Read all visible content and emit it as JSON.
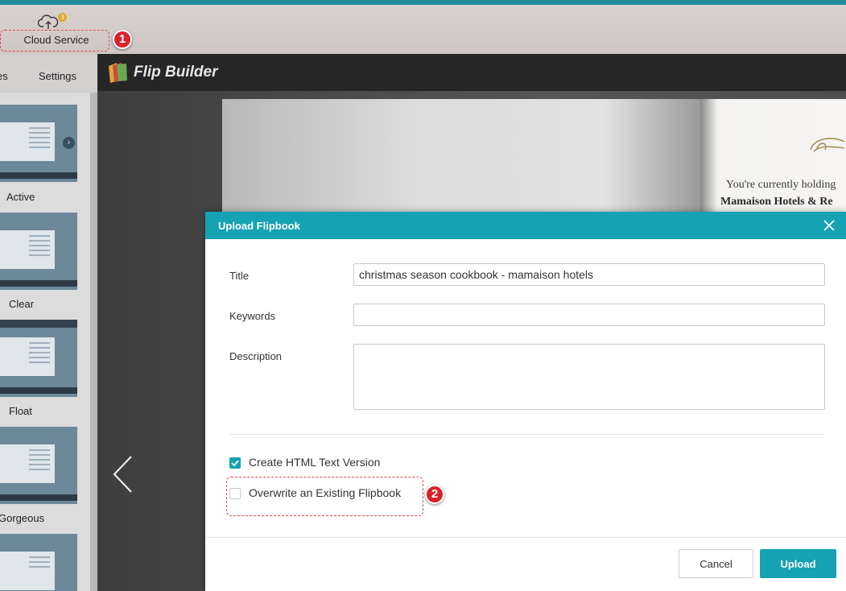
{
  "ribbon": {
    "cloud_service_label": "Cloud Service",
    "cloud_badge": "3",
    "callout_1": "1"
  },
  "left_panel": {
    "tabs": [
      "es",
      "Settings"
    ],
    "templates": [
      "Active",
      "Clear",
      "Float",
      "Gorgeous"
    ]
  },
  "viewer": {
    "app_title": "Flip Builder",
    "book_text_line1": "You're currently holding",
    "book_text_line2": "Mamaison Hotels & Re"
  },
  "dialog": {
    "title": "Upload Flipbook",
    "fields": {
      "title_label": "Title",
      "title_value": "christmas season cookbook - mamaison hotels",
      "keywords_label": "Keywords",
      "keywords_value": "",
      "description_label": "Description",
      "description_value": ""
    },
    "options": [
      {
        "label": "Create HTML Text Version",
        "checked": true
      },
      {
        "label": "Overwrite an Existing Flipbook",
        "checked": false
      }
    ],
    "callout_2": "2",
    "buttons": {
      "cancel": "Cancel",
      "upload": "Upload"
    }
  },
  "colors": {
    "accent": "#15a2b3",
    "callout": "#d9222b",
    "header_dark": "#262626"
  }
}
